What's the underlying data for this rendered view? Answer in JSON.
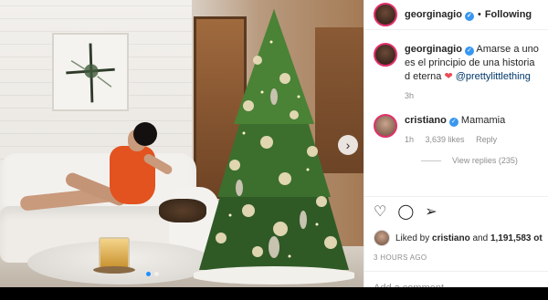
{
  "header": {
    "username": "georginagio",
    "verified_icon": "verified-badge-icon",
    "separator": "•",
    "follow_label": "Following"
  },
  "caption": {
    "username": "georginagio",
    "text": "Amarse a uno es el principio de una historia d eterna",
    "heart": "❤",
    "mention": "@prettylittlething",
    "time": "3h"
  },
  "comment": {
    "username": "cristiano",
    "text": "Mamamia",
    "time": "1h",
    "likes": "3,639 likes",
    "reply_label": "Reply"
  },
  "view_replies": "View replies (235)",
  "actions": {
    "like_icon": "heart-outline-icon",
    "comment_icon": "comment-bubble-icon",
    "share_icon": "paper-plane-icon"
  },
  "liked_by": {
    "prefix": "Liked by",
    "user": "cristiano",
    "conj": "and",
    "count": "1,191,583 ot"
  },
  "timestamp": "3 HOURS AGO",
  "add_comment": {
    "placeholder": "Add a comment..."
  },
  "carousel": {
    "next_icon": "chevron-right-icon",
    "slides": 2,
    "current": 1
  }
}
